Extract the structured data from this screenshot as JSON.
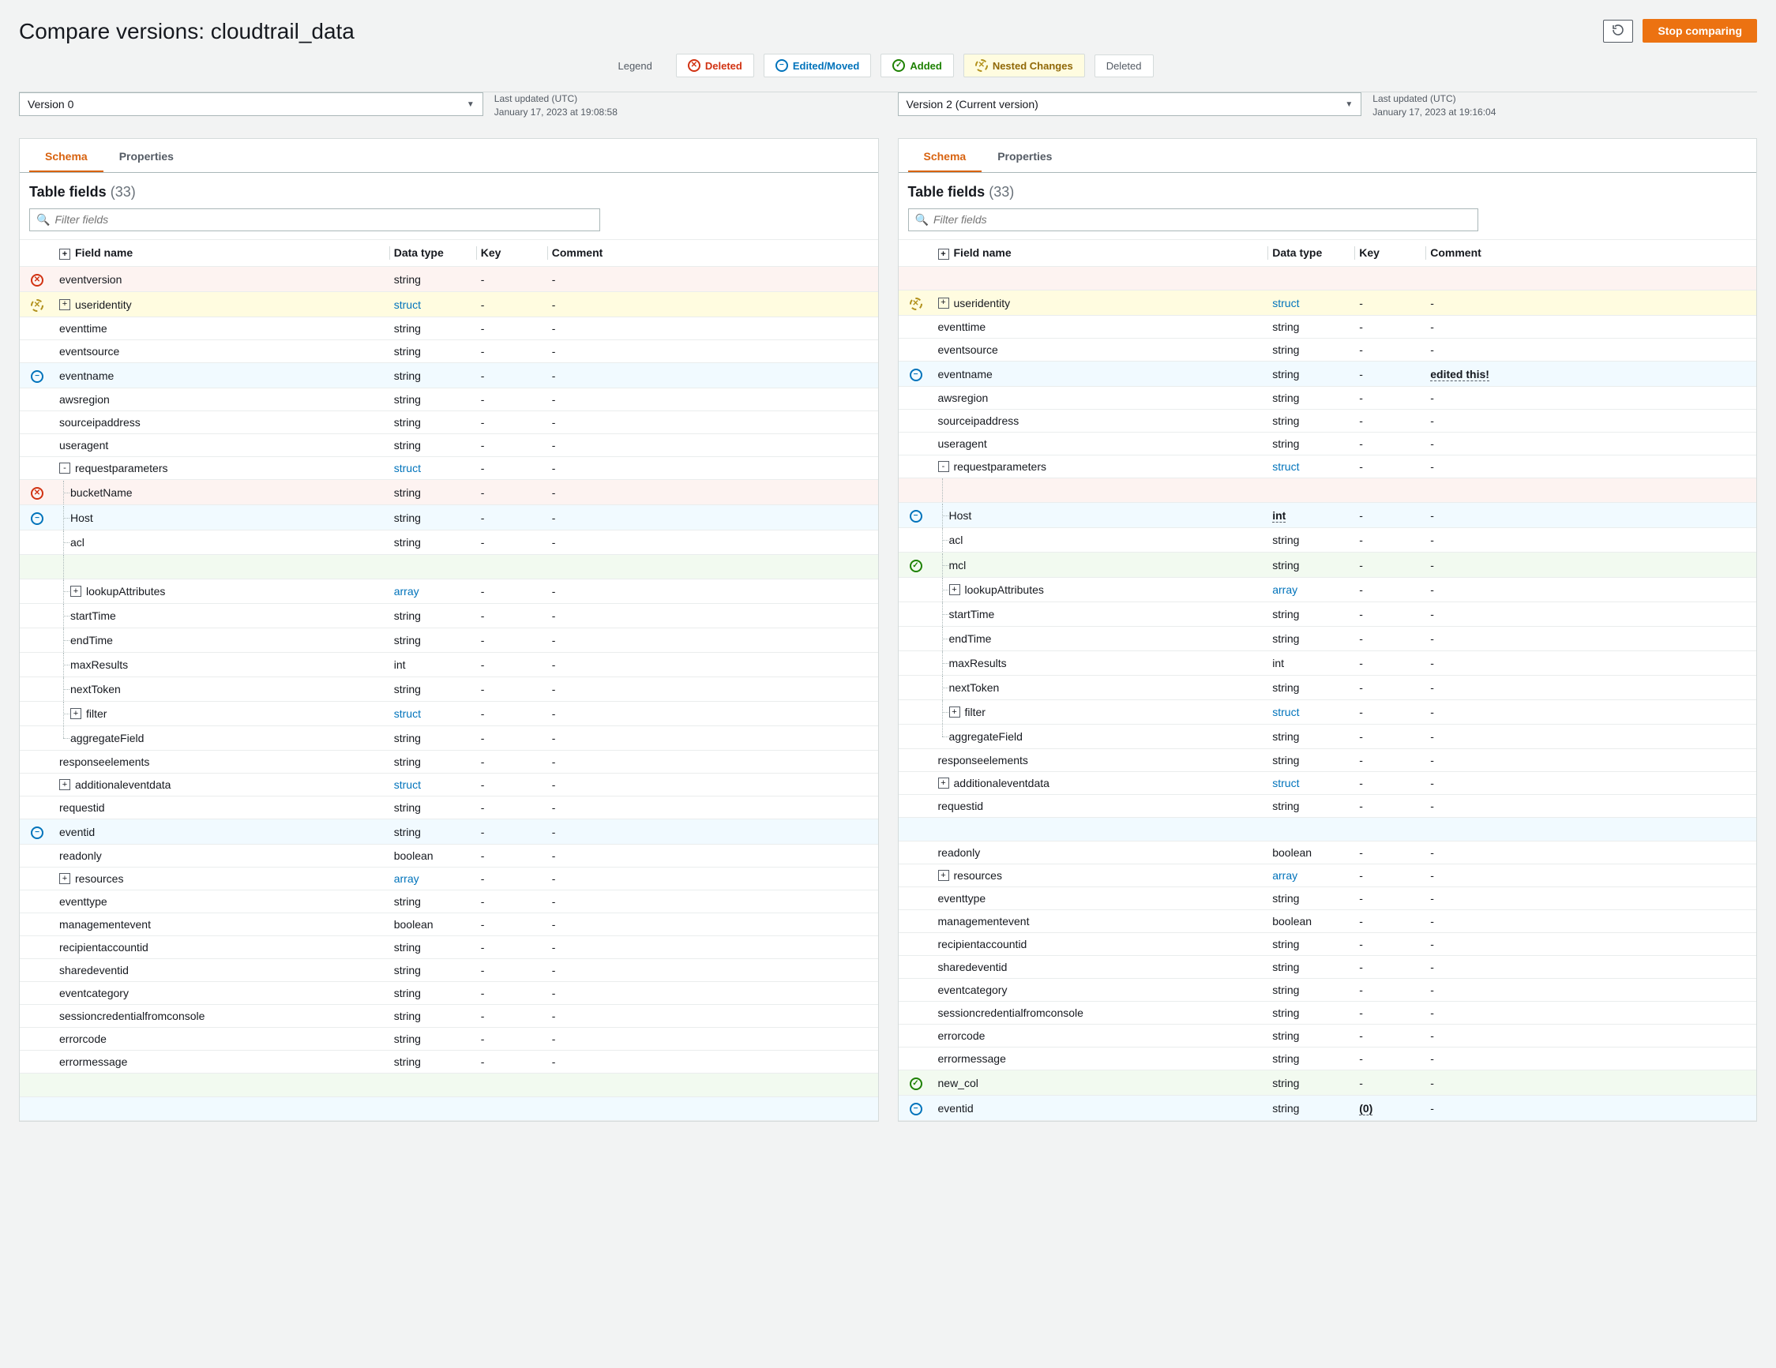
{
  "header": {
    "title": "Compare versions: cloudtrail_data",
    "stop_comparing": "Stop comparing"
  },
  "legend": {
    "label": "Legend",
    "deleted": "Deleted",
    "edited": "Edited/Moved",
    "added": "Added",
    "nested": "Nested Changes",
    "plain": "Deleted"
  },
  "left": {
    "version_label": "Version 0",
    "meta1": "Last updated (UTC)",
    "meta2": "January 17, 2023 at 19:08:58",
    "tab_schema": "Schema",
    "tab_props": "Properties",
    "table_fields_label": "Table fields",
    "table_fields_count": "(33)",
    "filter_placeholder": "Filter fields",
    "cols": {
      "name": "Field name",
      "type": "Data type",
      "key": "Key",
      "comment": "Comment"
    },
    "rows": [
      {
        "status": "deleted",
        "indent": 0,
        "expand": "",
        "name": "eventversion",
        "type": "string",
        "key": "-",
        "comment": "-",
        "tree": []
      },
      {
        "status": "nested",
        "indent": 0,
        "expand": "+",
        "name": "useridentity",
        "type": "struct",
        "typelink": true,
        "key": "-",
        "comment": "-",
        "tree": []
      },
      {
        "status": "",
        "indent": 0,
        "expand": "",
        "name": "eventtime",
        "type": "string",
        "key": "-",
        "comment": "-",
        "tree": []
      },
      {
        "status": "",
        "indent": 0,
        "expand": "",
        "name": "eventsource",
        "type": "string",
        "key": "-",
        "comment": "-",
        "tree": []
      },
      {
        "status": "edited",
        "indent": 0,
        "expand": "",
        "name": "eventname",
        "type": "string",
        "key": "-",
        "comment": "-",
        "tree": []
      },
      {
        "status": "",
        "indent": 0,
        "expand": "",
        "name": "awsregion",
        "type": "string",
        "key": "-",
        "comment": "-",
        "tree": []
      },
      {
        "status": "",
        "indent": 0,
        "expand": "",
        "name": "sourceipaddress",
        "type": "string",
        "key": "-",
        "comment": "-",
        "tree": []
      },
      {
        "status": "",
        "indent": 0,
        "expand": "",
        "name": "useragent",
        "type": "string",
        "key": "-",
        "comment": "-",
        "tree": []
      },
      {
        "status": "",
        "indent": 0,
        "expand": "-",
        "name": "requestparameters",
        "type": "struct",
        "typelink": true,
        "key": "-",
        "comment": "-",
        "tree": []
      },
      {
        "status": "deleted",
        "indent": 1,
        "expand": "",
        "name": "bucketName",
        "type": "string",
        "key": "-",
        "comment": "-",
        "tree": [
          "bc"
        ]
      },
      {
        "status": "edited",
        "indent": 1,
        "expand": "",
        "name": "Host",
        "type": "string",
        "key": "-",
        "comment": "-",
        "tree": [
          "bc"
        ]
      },
      {
        "status": "",
        "indent": 1,
        "expand": "",
        "name": "acl",
        "type": "string",
        "key": "-",
        "comment": "-",
        "tree": [
          "bc"
        ]
      },
      {
        "status": "blank",
        "indent": 1,
        "tree": [
          "v"
        ]
      },
      {
        "status": "",
        "indent": 1,
        "expand": "+",
        "name": "lookupAttributes",
        "type": "array",
        "typelink": true,
        "key": "-",
        "comment": "-",
        "tree": [
          "bc"
        ]
      },
      {
        "status": "",
        "indent": 1,
        "expand": "",
        "name": "startTime",
        "type": "string",
        "key": "-",
        "comment": "-",
        "tree": [
          "bc"
        ]
      },
      {
        "status": "",
        "indent": 1,
        "expand": "",
        "name": "endTime",
        "type": "string",
        "key": "-",
        "comment": "-",
        "tree": [
          "bc"
        ]
      },
      {
        "status": "",
        "indent": 1,
        "expand": "",
        "name": "maxResults",
        "type": "int",
        "key": "-",
        "comment": "-",
        "tree": [
          "bc"
        ]
      },
      {
        "status": "",
        "indent": 1,
        "expand": "",
        "name": "nextToken",
        "type": "string",
        "key": "-",
        "comment": "-",
        "tree": [
          "bc"
        ]
      },
      {
        "status": "",
        "indent": 1,
        "expand": "+",
        "name": "filter",
        "type": "struct",
        "typelink": true,
        "key": "-",
        "comment": "-",
        "tree": [
          "bc"
        ]
      },
      {
        "status": "",
        "indent": 1,
        "expand": "",
        "name": "aggregateField",
        "type": "string",
        "key": "-",
        "comment": "-",
        "tree": [
          "b"
        ]
      },
      {
        "status": "",
        "indent": 0,
        "expand": "",
        "name": "responseelements",
        "type": "string",
        "key": "-",
        "comment": "-",
        "tree": []
      },
      {
        "status": "",
        "indent": 0,
        "expand": "+",
        "name": "additionaleventdata",
        "type": "struct",
        "typelink": true,
        "key": "-",
        "comment": "-",
        "tree": []
      },
      {
        "status": "",
        "indent": 0,
        "expand": "",
        "name": "requestid",
        "type": "string",
        "key": "-",
        "comment": "-",
        "tree": []
      },
      {
        "status": "edited",
        "indent": 0,
        "expand": "",
        "name": "eventid",
        "type": "string",
        "key": "-",
        "comment": "-",
        "tree": []
      },
      {
        "status": "",
        "indent": 0,
        "expand": "",
        "name": "readonly",
        "type": "boolean",
        "key": "-",
        "comment": "-",
        "tree": []
      },
      {
        "status": "",
        "indent": 0,
        "expand": "+",
        "name": "resources",
        "type": "array",
        "typelink": true,
        "key": "-",
        "comment": "-",
        "tree": []
      },
      {
        "status": "",
        "indent": 0,
        "expand": "",
        "name": "eventtype",
        "type": "string",
        "key": "-",
        "comment": "-",
        "tree": []
      },
      {
        "status": "",
        "indent": 0,
        "expand": "",
        "name": "managementevent",
        "type": "boolean",
        "key": "-",
        "comment": "-",
        "tree": []
      },
      {
        "status": "",
        "indent": 0,
        "expand": "",
        "name": "recipientaccountid",
        "type": "string",
        "key": "-",
        "comment": "-",
        "tree": []
      },
      {
        "status": "",
        "indent": 0,
        "expand": "",
        "name": "sharedeventid",
        "type": "string",
        "key": "-",
        "comment": "-",
        "tree": []
      },
      {
        "status": "",
        "indent": 0,
        "expand": "",
        "name": "eventcategory",
        "type": "string",
        "key": "-",
        "comment": "-",
        "tree": []
      },
      {
        "status": "",
        "indent": 0,
        "expand": "",
        "name": "sessioncredentialfromconsole",
        "type": "string",
        "key": "-",
        "comment": "-",
        "tree": []
      },
      {
        "status": "",
        "indent": 0,
        "expand": "",
        "name": "errorcode",
        "type": "string",
        "key": "-",
        "comment": "-",
        "tree": []
      },
      {
        "status": "",
        "indent": 0,
        "expand": "",
        "name": "errormessage",
        "type": "string",
        "key": "-",
        "comment": "-",
        "tree": []
      },
      {
        "status": "blank",
        "indent": 0,
        "tree": []
      },
      {
        "status": "blank-blue",
        "indent": 0,
        "tree": []
      }
    ]
  },
  "right": {
    "version_label": "Version 2 (Current version)",
    "meta1": "Last updated (UTC)",
    "meta2": "January 17, 2023 at 19:16:04",
    "tab_schema": "Schema",
    "tab_props": "Properties",
    "table_fields_label": "Table fields",
    "table_fields_count": "(33)",
    "filter_placeholder": "Filter fields",
    "cols": {
      "name": "Field name",
      "type": "Data type",
      "key": "Key",
      "comment": "Comment"
    },
    "rows": [
      {
        "status": "blank-del",
        "indent": 0,
        "tree": []
      },
      {
        "status": "nested",
        "indent": 0,
        "expand": "+",
        "name": "useridentity",
        "type": "struct",
        "typelink": true,
        "key": "-",
        "comment": "-",
        "tree": []
      },
      {
        "status": "",
        "indent": 0,
        "expand": "",
        "name": "eventtime",
        "type": "string",
        "key": "-",
        "comment": "-",
        "tree": []
      },
      {
        "status": "",
        "indent": 0,
        "expand": "",
        "name": "eventsource",
        "type": "string",
        "key": "-",
        "comment": "-",
        "tree": []
      },
      {
        "status": "edited",
        "indent": 0,
        "expand": "",
        "name": "eventname",
        "type": "string",
        "key": "-",
        "comment": "edited this!",
        "commentdash": true,
        "tree": []
      },
      {
        "status": "",
        "indent": 0,
        "expand": "",
        "name": "awsregion",
        "type": "string",
        "key": "-",
        "comment": "-",
        "tree": []
      },
      {
        "status": "",
        "indent": 0,
        "expand": "",
        "name": "sourceipaddress",
        "type": "string",
        "key": "-",
        "comment": "-",
        "tree": []
      },
      {
        "status": "",
        "indent": 0,
        "expand": "",
        "name": "useragent",
        "type": "string",
        "key": "-",
        "comment": "-",
        "tree": []
      },
      {
        "status": "",
        "indent": 0,
        "expand": "-",
        "name": "requestparameters",
        "type": "struct",
        "typelink": true,
        "key": "-",
        "comment": "-",
        "tree": []
      },
      {
        "status": "blank-del",
        "indent": 1,
        "tree": [
          "v"
        ]
      },
      {
        "status": "edited",
        "indent": 1,
        "expand": "",
        "name": "Host",
        "type": "int",
        "typedash": true,
        "key": "-",
        "comment": "-",
        "tree": [
          "bc"
        ]
      },
      {
        "status": "",
        "indent": 1,
        "expand": "",
        "name": "acl",
        "type": "string",
        "key": "-",
        "comment": "-",
        "tree": [
          "bc"
        ]
      },
      {
        "status": "added",
        "indent": 1,
        "expand": "",
        "name": "mcl",
        "type": "string",
        "key": "-",
        "comment": "-",
        "tree": [
          "bc"
        ]
      },
      {
        "status": "",
        "indent": 1,
        "expand": "+",
        "name": "lookupAttributes",
        "type": "array",
        "typelink": true,
        "key": "-",
        "comment": "-",
        "tree": [
          "bc"
        ]
      },
      {
        "status": "",
        "indent": 1,
        "expand": "",
        "name": "startTime",
        "type": "string",
        "key": "-",
        "comment": "-",
        "tree": [
          "bc"
        ]
      },
      {
        "status": "",
        "indent": 1,
        "expand": "",
        "name": "endTime",
        "type": "string",
        "key": "-",
        "comment": "-",
        "tree": [
          "bc"
        ]
      },
      {
        "status": "",
        "indent": 1,
        "expand": "",
        "name": "maxResults",
        "type": "int",
        "key": "-",
        "comment": "-",
        "tree": [
          "bc"
        ]
      },
      {
        "status": "",
        "indent": 1,
        "expand": "",
        "name": "nextToken",
        "type": "string",
        "key": "-",
        "comment": "-",
        "tree": [
          "bc"
        ]
      },
      {
        "status": "",
        "indent": 1,
        "expand": "+",
        "name": "filter",
        "type": "struct",
        "typelink": true,
        "key": "-",
        "comment": "-",
        "tree": [
          "bc"
        ]
      },
      {
        "status": "",
        "indent": 1,
        "expand": "",
        "name": "aggregateField",
        "type": "string",
        "key": "-",
        "comment": "-",
        "tree": [
          "b"
        ]
      },
      {
        "status": "",
        "indent": 0,
        "expand": "",
        "name": "responseelements",
        "type": "string",
        "key": "-",
        "comment": "-",
        "tree": []
      },
      {
        "status": "",
        "indent": 0,
        "expand": "+",
        "name": "additionaleventdata",
        "type": "struct",
        "typelink": true,
        "key": "-",
        "comment": "-",
        "tree": []
      },
      {
        "status": "",
        "indent": 0,
        "expand": "",
        "name": "requestid",
        "type": "string",
        "key": "-",
        "comment": "-",
        "tree": []
      },
      {
        "status": "blank-blue",
        "indent": 0,
        "tree": []
      },
      {
        "status": "",
        "indent": 0,
        "expand": "",
        "name": "readonly",
        "type": "boolean",
        "key": "-",
        "comment": "-",
        "tree": []
      },
      {
        "status": "",
        "indent": 0,
        "expand": "+",
        "name": "resources",
        "type": "array",
        "typelink": true,
        "key": "-",
        "comment": "-",
        "tree": []
      },
      {
        "status": "",
        "indent": 0,
        "expand": "",
        "name": "eventtype",
        "type": "string",
        "key": "-",
        "comment": "-",
        "tree": []
      },
      {
        "status": "",
        "indent": 0,
        "expand": "",
        "name": "managementevent",
        "type": "boolean",
        "key": "-",
        "comment": "-",
        "tree": []
      },
      {
        "status": "",
        "indent": 0,
        "expand": "",
        "name": "recipientaccountid",
        "type": "string",
        "key": "-",
        "comment": "-",
        "tree": []
      },
      {
        "status": "",
        "indent": 0,
        "expand": "",
        "name": "sharedeventid",
        "type": "string",
        "key": "-",
        "comment": "-",
        "tree": []
      },
      {
        "status": "",
        "indent": 0,
        "expand": "",
        "name": "eventcategory",
        "type": "string",
        "key": "-",
        "comment": "-",
        "tree": []
      },
      {
        "status": "",
        "indent": 0,
        "expand": "",
        "name": "sessioncredentialfromconsole",
        "type": "string",
        "key": "-",
        "comment": "-",
        "tree": []
      },
      {
        "status": "",
        "indent": 0,
        "expand": "",
        "name": "errorcode",
        "type": "string",
        "key": "-",
        "comment": "-",
        "tree": []
      },
      {
        "status": "",
        "indent": 0,
        "expand": "",
        "name": "errormessage",
        "type": "string",
        "key": "-",
        "comment": "-",
        "tree": []
      },
      {
        "status": "added",
        "indent": 0,
        "expand": "",
        "name": "new_col",
        "type": "string",
        "key": "-",
        "comment": "-",
        "tree": []
      },
      {
        "status": "edited",
        "indent": 0,
        "expand": "",
        "name": "eventid",
        "type": "string",
        "key": "(0)",
        "keydash": true,
        "comment": "-",
        "tree": []
      }
    ]
  }
}
